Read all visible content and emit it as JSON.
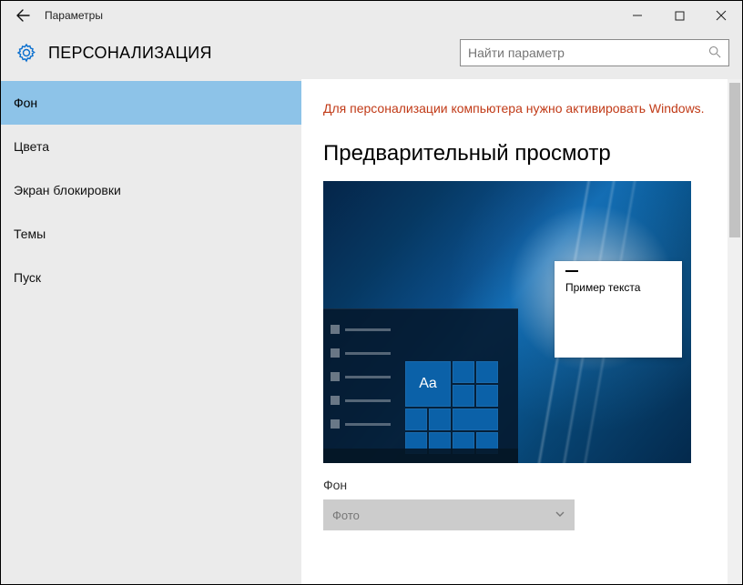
{
  "window": {
    "title": "Параметры"
  },
  "header": {
    "section": "ПЕРСОНАЛИЗАЦИЯ",
    "search_placeholder": "Найти параметр"
  },
  "sidebar": {
    "items": [
      {
        "label": "Фон",
        "active": true
      },
      {
        "label": "Цвета",
        "active": false
      },
      {
        "label": "Экран блокировки",
        "active": false
      },
      {
        "label": "Темы",
        "active": false
      },
      {
        "label": "Пуск",
        "active": false
      }
    ]
  },
  "main": {
    "warning": "Для персонализации компьютера нужно активировать Windows.",
    "preview_heading": "Предварительный просмотр",
    "sample_text": "Пример текста",
    "aa": "Aa",
    "bg_label": "Фон",
    "bg_value": "Фото"
  },
  "icons": {
    "back": "←",
    "minimize": "—",
    "maximize": "☐",
    "close": "✕",
    "search": "⌕",
    "chevron_down": "⌄"
  }
}
